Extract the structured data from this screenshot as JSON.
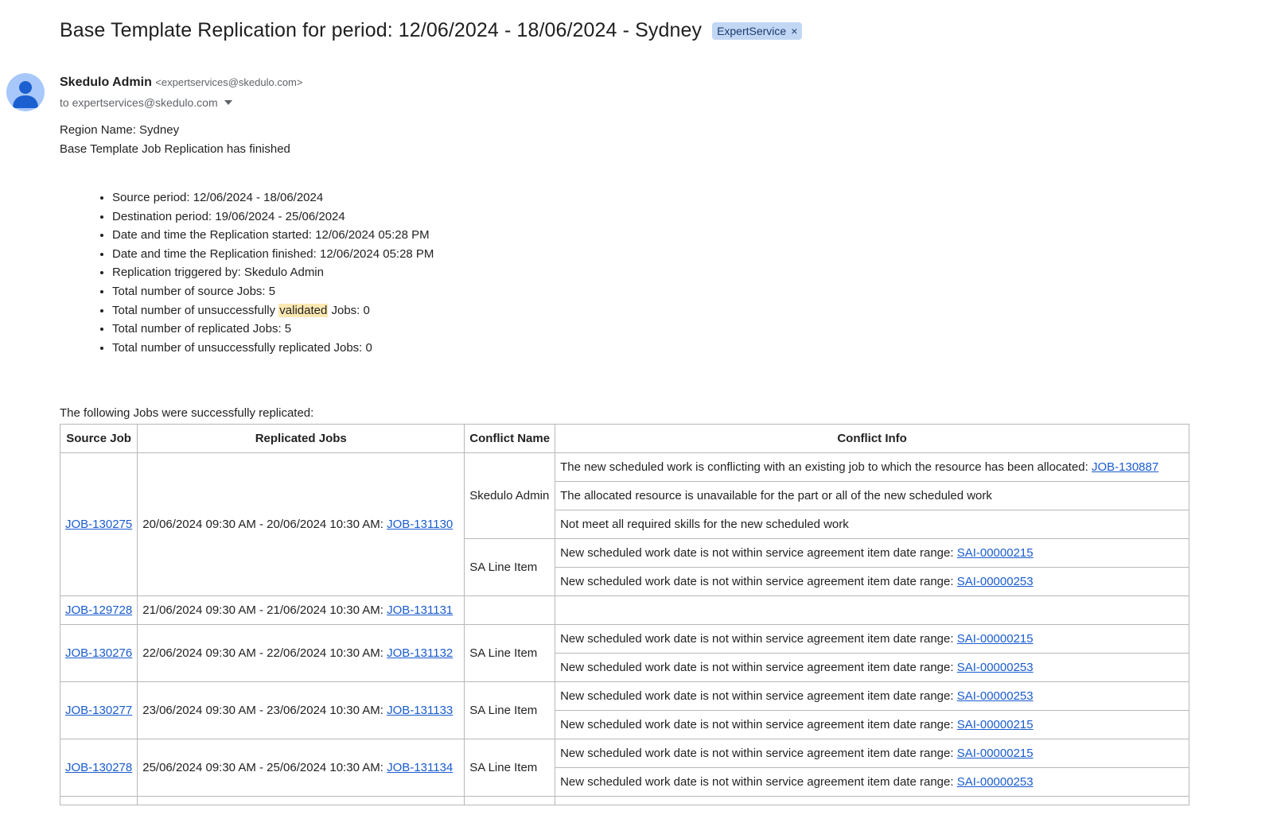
{
  "email": {
    "subject": "Base Template Replication for period: 12/06/2024 - 18/06/2024 - Sydney",
    "label": "ExpertService",
    "label_remove": "×",
    "sender_name": "Skedulo Admin",
    "sender_email": "<expertservices@skedulo.com>",
    "recipient": "to expertservices@skedulo.com"
  },
  "body": {
    "region_line": "Region Name: Sydney",
    "finished_line": "Base Template Job Replication has finished",
    "summary": [
      "Source period: 12/06/2024 - 18/06/2024",
      "Destination period: 19/06/2024 - 25/06/2024",
      "Date and time the Replication started: 12/06/2024 05:28 PM",
      "Date and time the Replication finished: 12/06/2024 05:28 PM",
      "Replication triggered by: Skedulo Admin",
      "Total number of source Jobs: 5",
      "Total number of unsuccessfully ",
      "Total number of replicated Jobs: 5",
      "Total number of unsuccessfully replicated Jobs: 0"
    ],
    "summary_highlight": "validated",
    "summary_after_highlight": " Jobs: 0",
    "table_intro": "The following Jobs were successfully replicated:"
  },
  "table": {
    "headers": [
      "Source Job",
      "Replicated Jobs",
      "Conflict Name",
      "Conflict Info"
    ],
    "rows": [
      {
        "source": "JOB-130275",
        "replicated_text": "20/06/2024 09:30 AM - 20/06/2024 10:30 AM: ",
        "replicated_link": "JOB-131130",
        "groups": [
          {
            "name": "Skedulo Admin",
            "infos": [
              {
                "text": "The new scheduled work is conflicting with an existing job to which the resource has been allocated: ",
                "link": "JOB-130887"
              },
              {
                "text": "The allocated resource is unavailable for the part or all of the new scheduled work",
                "link": ""
              },
              {
                "text": "Not meet all required skills for the new scheduled work",
                "link": ""
              }
            ]
          },
          {
            "name": "SA Line Item",
            "infos": [
              {
                "text": "New scheduled work date is not within service agreement item date range: ",
                "link": "SAI-00000215"
              },
              {
                "text": "New scheduled work date is not within service agreement item date range: ",
                "link": "SAI-00000253"
              }
            ]
          }
        ]
      },
      {
        "source": "JOB-129728",
        "replicated_text": "21/06/2024 09:30 AM - 21/06/2024 10:30 AM: ",
        "replicated_link": "JOB-131131",
        "groups": [
          {
            "name": "",
            "infos": [
              {
                "text": "",
                "link": ""
              }
            ]
          }
        ]
      },
      {
        "source": "JOB-130276",
        "replicated_text": "22/06/2024 09:30 AM - 22/06/2024 10:30 AM: ",
        "replicated_link": "JOB-131132",
        "groups": [
          {
            "name": "SA Line Item",
            "infos": [
              {
                "text": "New scheduled work date is not within service agreement item date range: ",
                "link": "SAI-00000215"
              },
              {
                "text": "New scheduled work date is not within service agreement item date range: ",
                "link": "SAI-00000253"
              }
            ]
          }
        ]
      },
      {
        "source": "JOB-130277",
        "replicated_text": "23/06/2024 09:30 AM - 23/06/2024 10:30 AM: ",
        "replicated_link": "JOB-131133",
        "groups": [
          {
            "name": "SA Line Item",
            "infos": [
              {
                "text": "New scheduled work date is not within service agreement item date range: ",
                "link": "SAI-00000253"
              },
              {
                "text": "New scheduled work date is not within service agreement item date range: ",
                "link": "SAI-00000215"
              }
            ]
          }
        ]
      },
      {
        "source": "JOB-130278",
        "replicated_text": "25/06/2024 09:30 AM - 25/06/2024 10:30 AM: ",
        "replicated_link": "JOB-131134",
        "groups": [
          {
            "name": "SA Line Item",
            "infos": [
              {
                "text": "New scheduled work date is not within service agreement item date range: ",
                "link": "SAI-00000215"
              },
              {
                "text": "New scheduled work date is not within service agreement item date range: ",
                "link": "SAI-00000253"
              }
            ]
          }
        ]
      }
    ]
  }
}
